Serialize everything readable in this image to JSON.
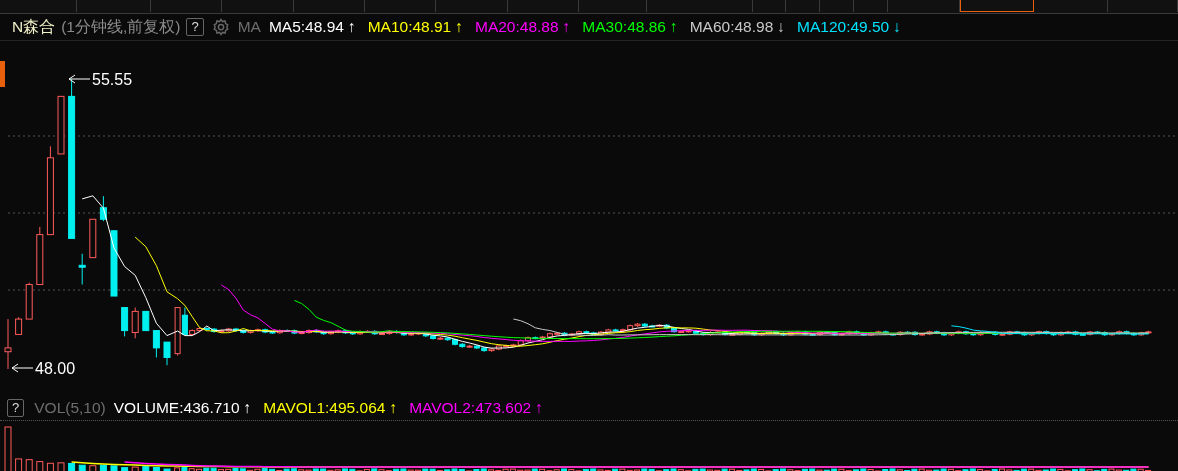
{
  "tabs": [
    {
      "selected": false
    },
    {
      "selected": false
    },
    {
      "selected": false
    },
    {
      "selected": false
    },
    {
      "selected": false
    },
    {
      "selected": false
    },
    {
      "selected": false
    },
    {
      "selected": false
    },
    {
      "selected": false
    },
    {
      "selected": false
    },
    {
      "selected": false
    },
    {
      "selected": false
    },
    {
      "selected": false
    },
    {
      "selected": false
    },
    {
      "selected": false
    },
    {
      "selected": true
    },
    {
      "selected": false
    },
    {
      "selected": false
    }
  ],
  "header": {
    "symbol": "N森合",
    "period": "(1分钟线,前复权)",
    "help": "?",
    "indicator": "MA",
    "averages": [
      {
        "label": "MA5:48.94",
        "arrow": "↑",
        "color": "#ffffff"
      },
      {
        "label": "MA10:48.91",
        "arrow": "↑",
        "color": "#ffff00"
      },
      {
        "label": "MA20:48.88",
        "arrow": "↑",
        "color": "#ff00ff"
      },
      {
        "label": "MA30:48.86",
        "arrow": "↑",
        "color": "#00ff00"
      },
      {
        "label": "MA60:48.98",
        "arrow": "↓",
        "color": "#c8c8c8"
      },
      {
        "label": "MA120:49.50",
        "arrow": "↓",
        "color": "#00e5ff"
      }
    ]
  },
  "chart": {
    "high_label": "55.55",
    "low_label": "48.00"
  },
  "volume_header": {
    "help": "?",
    "indicator": "VOL(5,10)",
    "items": [
      {
        "label": "VOLUME:436.710",
        "arrow": "↑",
        "color": "#ffffff"
      },
      {
        "label": "MAVOL1:495.064",
        "arrow": "↑",
        "color": "#ffff00"
      },
      {
        "label": "MAVOL2:473.602",
        "arrow": "↑",
        "color": "#ff00ff"
      }
    ]
  }
}
